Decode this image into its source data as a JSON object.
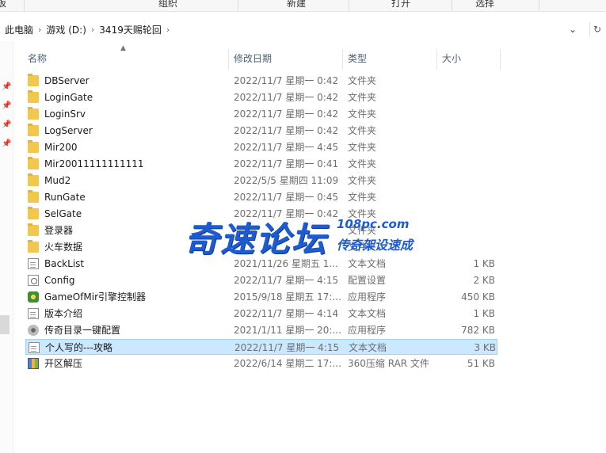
{
  "ribbon": {
    "groups": [
      "板",
      "组织",
      "新建",
      "打开",
      "选择"
    ]
  },
  "address": {
    "crumbs": [
      "此电脑",
      "游戏 (D:)",
      "3419天赐轮回"
    ],
    "dropdown_icon": "chevron-down-icon",
    "refresh_icon": "refresh-icon"
  },
  "columns": {
    "name": "名称",
    "date": "修改日期",
    "type": "类型",
    "size": "大小"
  },
  "files": [
    {
      "name": "DBServer",
      "date": "2022/11/7 星期一 0:42",
      "type": "文件夹",
      "size": "",
      "icon": "folder"
    },
    {
      "name": "LoginGate",
      "date": "2022/11/7 星期一 0:42",
      "type": "文件夹",
      "size": "",
      "icon": "folder"
    },
    {
      "name": "LoginSrv",
      "date": "2022/11/7 星期一 0:42",
      "type": "文件夹",
      "size": "",
      "icon": "folder"
    },
    {
      "name": "LogServer",
      "date": "2022/11/7 星期一 0:42",
      "type": "文件夹",
      "size": "",
      "icon": "folder"
    },
    {
      "name": "Mir200",
      "date": "2022/11/7 星期一 4:45",
      "type": "文件夹",
      "size": "",
      "icon": "folder"
    },
    {
      "name": "Mir20011111111111",
      "date": "2022/11/7 星期一 0:41",
      "type": "文件夹",
      "size": "",
      "icon": "folder"
    },
    {
      "name": "Mud2",
      "date": "2022/5/5 星期四 11:09",
      "type": "文件夹",
      "size": "",
      "icon": "folder"
    },
    {
      "name": "RunGate",
      "date": "2022/11/7 星期一 0:45",
      "type": "文件夹",
      "size": "",
      "icon": "folder"
    },
    {
      "name": "SelGate",
      "date": "2022/11/7 星期一 0:42",
      "type": "文件夹",
      "size": "",
      "icon": "folder"
    },
    {
      "name": "登录器",
      "date": "",
      "type": "文件夹",
      "size": "",
      "icon": "folder"
    },
    {
      "name": "火车数据",
      "date": "",
      "type": "文件夹",
      "size": "",
      "icon": "folder"
    },
    {
      "name": "BackList",
      "date": "2021/11/26 星期五 1...",
      "type": "文本文档",
      "size": "1 KB",
      "icon": "doc"
    },
    {
      "name": "Config",
      "date": "2022/11/7 星期一 4:15",
      "type": "配置设置",
      "size": "2 KB",
      "icon": "cfg"
    },
    {
      "name": "GameOfMir引擎控制器",
      "date": "2015/9/18 星期五 17:...",
      "type": "应用程序",
      "size": "450 KB",
      "icon": "exe-game"
    },
    {
      "name": "版本介绍",
      "date": "2022/11/7 星期一 4:14",
      "type": "文本文档",
      "size": "1 KB",
      "icon": "doc"
    },
    {
      "name": "传奇目录一键配置",
      "date": "2021/1/11 星期一 20:...",
      "type": "应用程序",
      "size": "782 KB",
      "icon": "exe-cfg"
    },
    {
      "name": "个人写的---攻略",
      "date": "2022/11/7 星期一 4:15",
      "type": "文本文档",
      "size": "3 KB",
      "icon": "doc",
      "selected": true
    },
    {
      "name": "开区解压",
      "date": "2022/6/14 星期二 17:...",
      "type": "360压缩 RAR 文件",
      "size": "51 KB",
      "icon": "rar"
    }
  ],
  "watermark": {
    "main": "奇速论坛",
    "url": "108pc.com",
    "sub": "传奇架设速成"
  }
}
